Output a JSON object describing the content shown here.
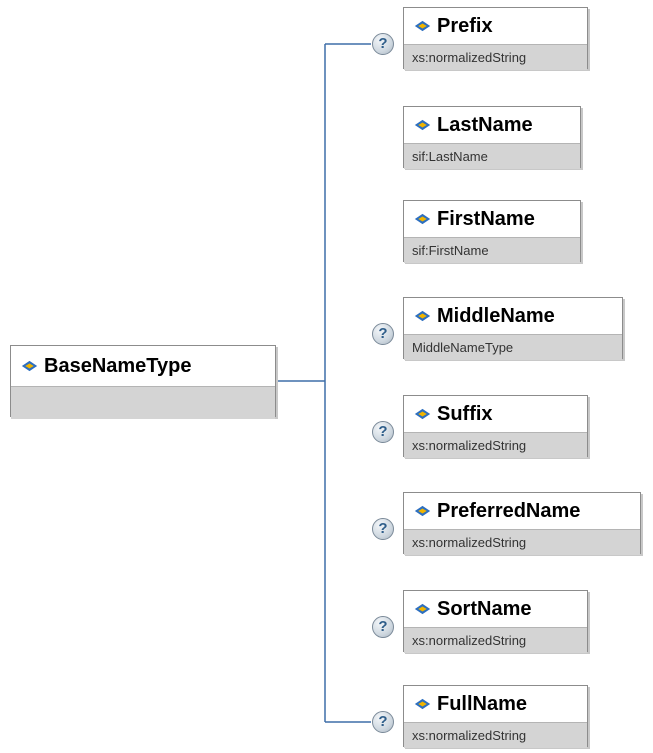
{
  "root": {
    "name": "BaseNameType",
    "type": ""
  },
  "children": [
    {
      "name": "Prefix",
      "type": "xs:normalizedString",
      "optional": true
    },
    {
      "name": "LastName",
      "type": "sif:LastName",
      "optional": false
    },
    {
      "name": "FirstName",
      "type": "sif:FirstName",
      "optional": false
    },
    {
      "name": "MiddleName",
      "type": "MiddleNameType",
      "optional": true
    },
    {
      "name": "Suffix",
      "type": "xs:normalizedString",
      "optional": true
    },
    {
      "name": "PreferredName",
      "type": "xs:normalizedString",
      "optional": true
    },
    {
      "name": "SortName",
      "type": "xs:normalizedString",
      "optional": true
    },
    {
      "name": "FullName",
      "type": "xs:normalizedString",
      "optional": true
    }
  ],
  "optional_marker": "?",
  "colors": {
    "connector": "#3f6ea8",
    "type_band": "#d4d4d4",
    "node_border": "#8c8c8c",
    "icon_blue": "#2d6fc0",
    "icon_gold": "#f0b400"
  },
  "icons": {
    "element": "element-diamond-icon",
    "optional": "question-icon"
  }
}
